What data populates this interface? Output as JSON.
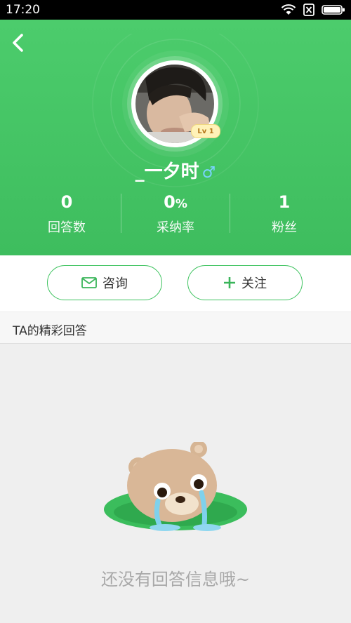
{
  "status_bar": {
    "time": "17:20",
    "wifi_icon": "wifi-icon",
    "sim_icon": "no-sim-icon",
    "battery_icon": "battery-icon"
  },
  "header": {
    "back_icon": "back-arrow-icon",
    "username": "_一夕时",
    "gender_symbol": "♂",
    "level_badge": "Lv 1",
    "accent_color": "#3ebd5e",
    "stats": [
      {
        "value": "0",
        "suffix": "",
        "label": "回答数"
      },
      {
        "value": "0",
        "suffix": "%",
        "label": "采纳率"
      },
      {
        "value": "1",
        "suffix": "",
        "label": "粉丝"
      }
    ]
  },
  "actions": {
    "consult_label": "咨询",
    "consult_icon": "mail-icon",
    "follow_label": "关注",
    "follow_icon": "plus-icon"
  },
  "section": {
    "title": "TA的精彩回答"
  },
  "empty_state": {
    "illustration": "crying-bear-illustration",
    "message": "还没有回答信息哦~"
  }
}
